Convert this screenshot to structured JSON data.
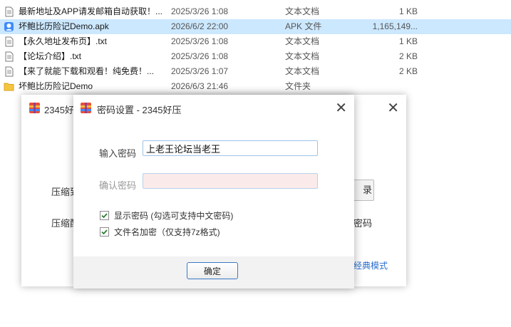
{
  "files": [
    {
      "name": "最新地址及APP请发邮箱自动获取！...",
      "date": "2025/3/26 1:08",
      "type": "文本文档",
      "size": "1 KB",
      "icon": "text-file-icon",
      "selected": false
    },
    {
      "name": "坏鲍比历险记Demo.apk",
      "date": "2026/6/2 22:00",
      "type": "APK 文件",
      "size": "1,165,149...",
      "icon": "apk-file-icon",
      "selected": true
    },
    {
      "name": "【永久地址发布页】.txt",
      "date": "2025/3/26 1:08",
      "type": "文本文档",
      "size": "1 KB",
      "icon": "text-file-icon",
      "selected": false
    },
    {
      "name": "【论坛介绍】.txt",
      "date": "2025/3/26 1:08",
      "type": "文本文档",
      "size": "2 KB",
      "icon": "text-file-icon",
      "selected": false
    },
    {
      "name": "【来了就能下载和观看！纯免费！...",
      "date": "2025/3/26 1:07",
      "type": "文本文档",
      "size": "2 KB",
      "icon": "text-file-icon",
      "selected": false
    },
    {
      "name": "坏鲍比历险记Demo",
      "date": "2026/6/3 21:46",
      "type": "文件夹",
      "size": "",
      "icon": "folder-icon",
      "selected": false
    }
  ],
  "back_window": {
    "title": "2345好",
    "close": "✕",
    "label1": "压缩到",
    "label2": "压缩配",
    "browse_fragment": "录",
    "right_fragment": "密码",
    "classic_mode": "经典模式"
  },
  "dialog": {
    "title": "密码设置 - 2345好压",
    "close": "✕",
    "password_label": "输入密码",
    "password_value": "上老王论坛当老王",
    "confirm_label": "确认密码",
    "confirm_value": "",
    "show_password": "显示密码 (勾选可支持中文密码)",
    "encrypt_names": "文件名加密（仅支持7z格式)",
    "ok": "确定"
  },
  "colors": {
    "selection": "#cce8ff",
    "accent": "#3b78c6",
    "checkmark": "#2e7d32",
    "link": "#2a6fcf"
  }
}
